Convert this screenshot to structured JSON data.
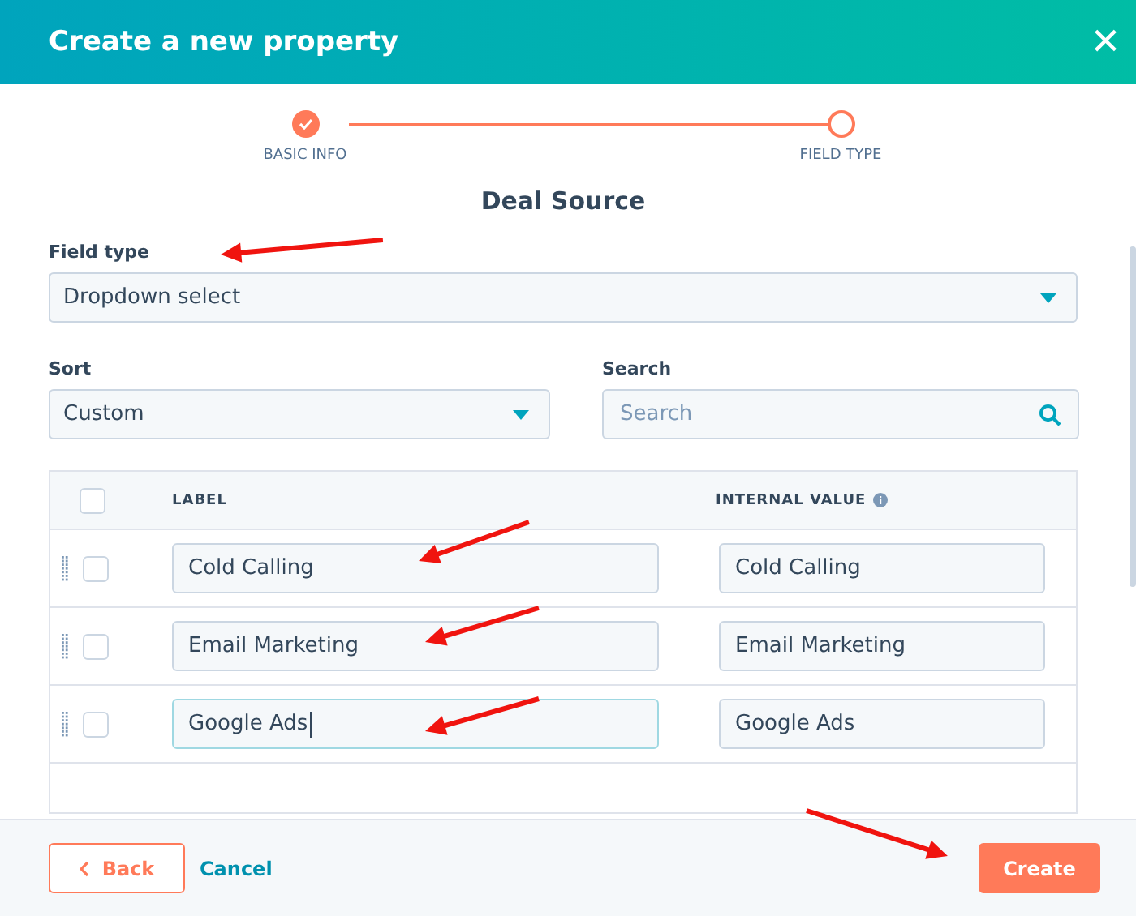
{
  "header": {
    "title": "Create a new property",
    "close": "×"
  },
  "steps": [
    {
      "label": "BASIC INFO",
      "completed": true
    },
    {
      "label": "FIELD TYPE",
      "completed": false
    }
  ],
  "heading": "Deal Source",
  "field_type": {
    "label": "Field type",
    "value": "Dropdown select"
  },
  "sort": {
    "label": "Sort",
    "value": "Custom"
  },
  "search": {
    "label": "Search",
    "placeholder": "Search"
  },
  "table": {
    "select_all_checked": false,
    "columns": [
      "LABEL",
      "INTERNAL VALUE"
    ],
    "rows": [
      {
        "label": "Cold Calling",
        "internal_value": "Cold Calling",
        "checked": false,
        "focused": false
      },
      {
        "label": "Email Marketing",
        "internal_value": "Email Marketing",
        "checked": false,
        "focused": false
      },
      {
        "label": "Google Ads",
        "internal_value": "Google Ads",
        "checked": false,
        "focused": true
      }
    ]
  },
  "footer": {
    "back": "Back",
    "cancel": "Cancel",
    "create": "Create"
  }
}
